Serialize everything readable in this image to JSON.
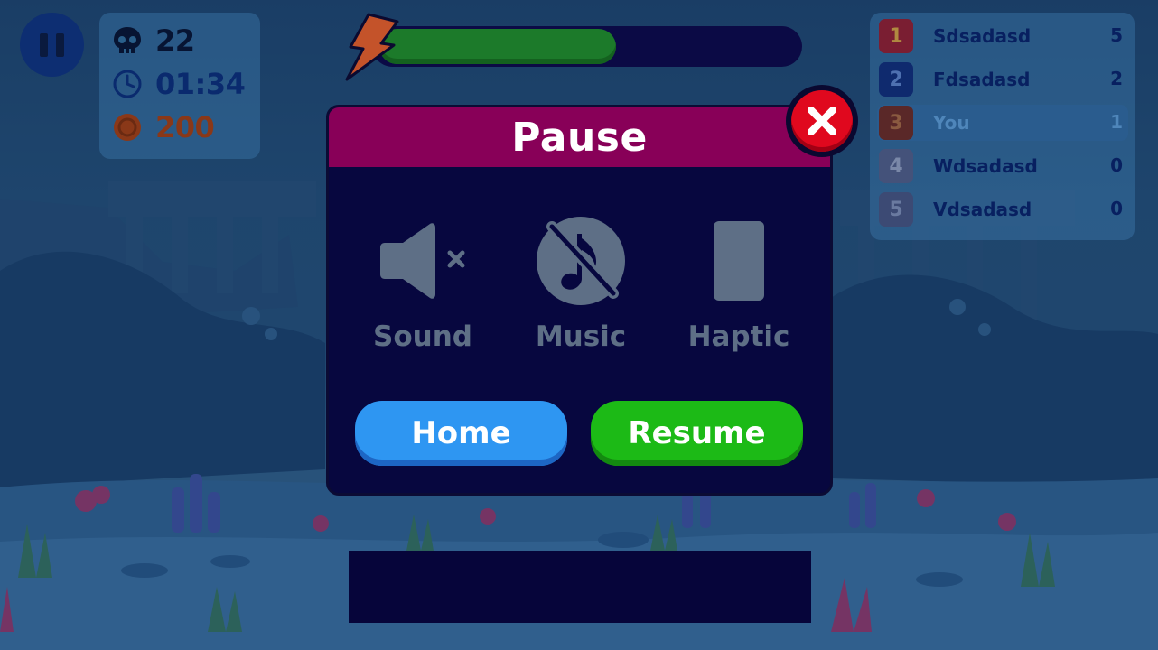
{
  "hud": {
    "kills": "22",
    "timer": "01:34",
    "coins": "200",
    "energy_fraction": 0.57
  },
  "leaderboard": [
    {
      "rank": "1",
      "name": "Sdsadasd",
      "score": "5",
      "color": "#7a1e32",
      "text": "#b08a40"
    },
    {
      "rank": "2",
      "name": "Fdsadasd",
      "score": "2",
      "color": "#0f2a6e",
      "text": "#4e70b0"
    },
    {
      "rank": "3",
      "name": "You",
      "score": "1",
      "color": "#5a2828",
      "text": "#8a5a40",
      "me": true
    },
    {
      "rank": "4",
      "name": "Wdsadasd",
      "score": "0",
      "color": "#44527a",
      "text": "#7a88a8"
    },
    {
      "rank": "5",
      "name": "Vdsadasd",
      "score": "0",
      "color": "#3c4a74",
      "text": "#6a7aa0"
    }
  ],
  "dialog": {
    "title": "Pause",
    "options": [
      {
        "label": "Sound",
        "icon": "speaker-muted-icon"
      },
      {
        "label": "Music",
        "icon": "music-off-icon"
      },
      {
        "label": "Haptic",
        "icon": "phone-vibrate-icon"
      }
    ],
    "home_label": "Home",
    "resume_label": "Resume"
  }
}
